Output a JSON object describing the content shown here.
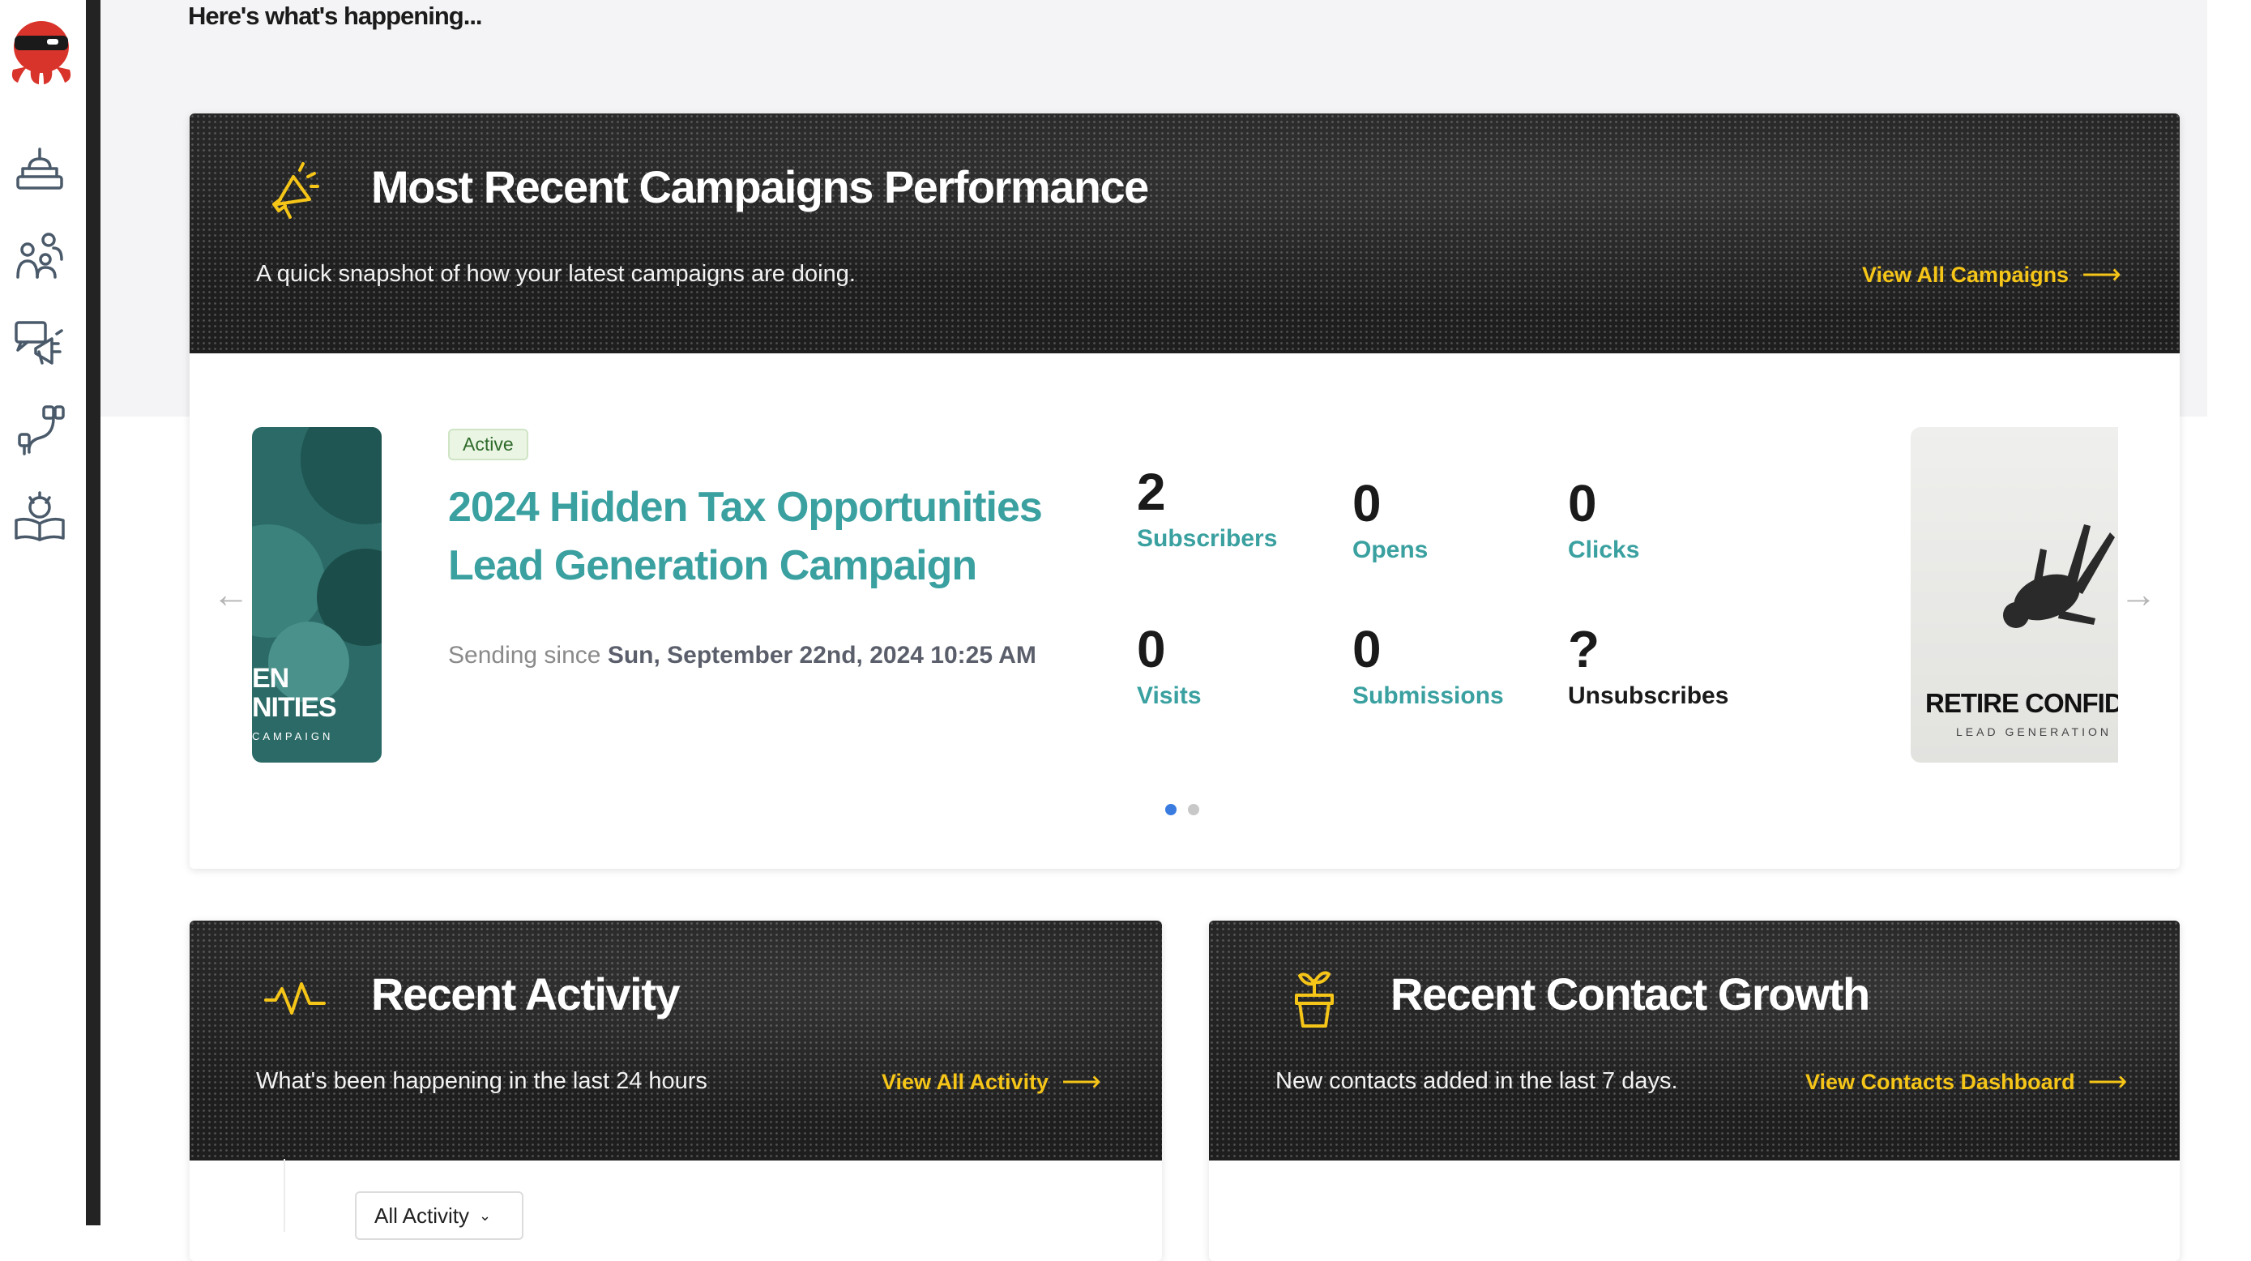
{
  "greeting": "Here's what's happening...",
  "sidebar": {
    "logo": "ninja-mascot-logo",
    "items": [
      {
        "icon": "dashboard-inbox-icon"
      },
      {
        "icon": "contacts-group-icon"
      },
      {
        "icon": "campaigns-megaphone-icon"
      },
      {
        "icon": "automation-flow-icon"
      },
      {
        "icon": "learning-book-icon"
      }
    ]
  },
  "campaigns_card": {
    "icon": "megaphone-icon",
    "title": "Most Recent Campaigns Performance",
    "subtitle": "A quick snapshot of how your latest campaigns are doing.",
    "link_label": "View All Campaigns",
    "campaign": {
      "status": "Active",
      "title": "2024 Hidden Tax Opportunities Lead Generation Campaign",
      "sending_prefix": "Sending since",
      "sending_date": "Sun, September 22nd, 2024 10:25 AM",
      "thumb_text_line1": "EN",
      "thumb_text_line2": "NITIES",
      "thumb_text_line3": "CAMPAIGN",
      "stats": [
        {
          "value": "2",
          "label": "Subscribers"
        },
        {
          "value": "0",
          "label": "Opens"
        },
        {
          "value": "0",
          "label": "Clicks"
        },
        {
          "value": "0",
          "label": "Visits"
        },
        {
          "value": "0",
          "label": "Submissions"
        },
        {
          "value": "?",
          "label": "Unsubscribes"
        }
      ]
    },
    "next_campaign": {
      "title": "RETIRE CONFIDENTLY",
      "subtitle": "LEAD GENERATION"
    },
    "prev_arrow": "←",
    "next_arrow": "→",
    "carousel_active_index": 0
  },
  "activity_card": {
    "icon": "activity-pulse-icon",
    "title": "Recent Activity",
    "subtitle": "What's been happening in the last 24 hours",
    "link_label": "View All Activity",
    "filter_value": "All Activity"
  },
  "growth_card": {
    "icon": "plant-pot-icon",
    "title": "Recent Contact Growth",
    "subtitle": "New contacts added in the last 7 days.",
    "link_label": "View Contacts Dashboard"
  },
  "colors": {
    "accent_teal": "#3aa0a0",
    "link_yellow": "#f5c518",
    "header_dark": "#1e1e1e",
    "dot_active": "#3a7be0"
  }
}
